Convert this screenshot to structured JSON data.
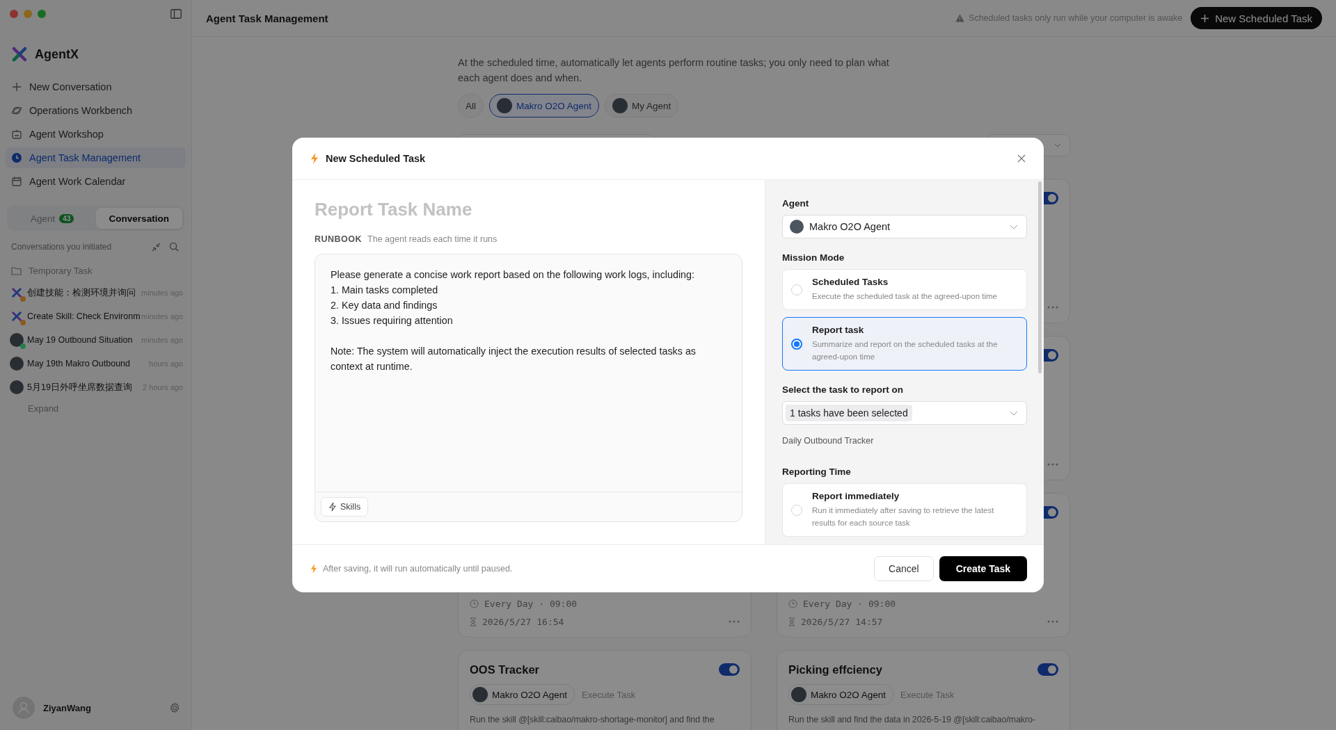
{
  "sidebar": {
    "brand": "AgentX",
    "nav": [
      {
        "kind": "new",
        "label": "New Conversation",
        "selected": false
      },
      {
        "kind": "workbench",
        "label": "Operations Workbench",
        "selected": false
      },
      {
        "kind": "workshop",
        "label": "Agent Workshop",
        "selected": false
      },
      {
        "kind": "tasks",
        "label": "Agent Task Management",
        "selected": true
      },
      {
        "kind": "calendar",
        "label": "Agent Work Calendar",
        "selected": false
      }
    ],
    "tabs": [
      {
        "label": "Agent",
        "badge": "43",
        "selected": false
      },
      {
        "label": "Conversation",
        "selected": true
      }
    ],
    "list_title": "Conversations you initiated",
    "folder": "Temporary Task",
    "conversations": [
      {
        "kind": "agentx",
        "title": "创建技能：检测环境并询问",
        "time": "minutes ago",
        "color": "#8a5a1c"
      },
      {
        "kind": "agentx",
        "title": "Create Skill: Check Environm",
        "time": "minutes ago",
        "color": "#8a5a1c"
      },
      {
        "kind": "person",
        "title": "May 19 Outbound Situation",
        "time": "minutes ago",
        "color": "#24804a"
      },
      {
        "kind": "person",
        "title": "May 19th Makro Outbound",
        "time": "hours ago"
      },
      {
        "kind": "person",
        "title": "5月19日外呼坐席数据查询",
        "time": "2 hours ago"
      }
    ],
    "expand": "Expand",
    "user": {
      "name": "ZiyanWang"
    }
  },
  "header": {
    "title": "Agent Task Management",
    "notice": "Scheduled tasks only run while your computer is awake",
    "new_button": "New Scheduled Task"
  },
  "intro": "At the scheduled time, automatically let agents perform routine tasks; you only need to plan what each agent does and when.",
  "filters": [
    {
      "kind": "plain",
      "label": "All",
      "selected": false
    },
    {
      "kind": "agent",
      "label": "Makro O2O Agent",
      "selected": true
    },
    {
      "kind": "agent",
      "label": "My Agent",
      "selected": false
    }
  ],
  "cards": [
    {
      "kind": "task",
      "enabled": true
    },
    {
      "kind": "task",
      "enabled": true
    },
    {
      "kind": "task",
      "schedule": "Every Day · 09:00",
      "last_run": "2026/5/27 16:54"
    },
    {
      "kind": "task",
      "enabled": true,
      "schedule": "Every Day · 09:00",
      "last_run": "2026/5/27 14:57"
    },
    {
      "kind": "task",
      "title": "OOS Tracker",
      "enabled": true,
      "agent": "Makro O2O Agent",
      "mode": "Execute Task",
      "description": "Run the skill @[skill:caibao/makro-shortage-monitor] and find the"
    },
    {
      "kind": "task",
      "title": "Picking effciency",
      "enabled": true,
      "agent": "Makro O2O Agent",
      "mode": "Execute Task",
      "description": "Run the skill and find the data in 2026-5-19 @[skill:caibao/makro-"
    }
  ],
  "dialog": {
    "title": "New Scheduled Task",
    "name_placeholder": "Report Task Name",
    "runbook_label": "RUNBOOK",
    "runbook_hint": "The agent reads each time it runs",
    "runbook": "Please generate a concise work report based on the following work logs, including:\n1. Main tasks completed\n2. Key data and findings\n3. Issues requiring attention\n\nNote: The system will automatically inject the execution results of selected tasks as context at runtime.",
    "skills_button": "Skills",
    "agent_label": "Agent",
    "agent_value": "Makro O2O Agent",
    "mode_label": "Mission Mode",
    "modes": [
      {
        "title": "Scheduled Tasks",
        "description": "Execute the scheduled task at the agreed-upon time",
        "selected": false
      },
      {
        "title": "Report task",
        "description": "Summarize and report on the scheduled tasks at the agreed-upon time",
        "selected": true
      }
    ],
    "report_label": "Select the task to report on",
    "report_value": "1 tasks have been selected",
    "selected_tasks": [
      "Daily Outbound Tracker"
    ],
    "time_label": "Reporting Time",
    "times": [
      {
        "title": "Report immediately",
        "description": "Run it immediately after saving to retrieve the latest results for each source task",
        "selected": false
      }
    ],
    "footer_note": "After saving, it will run automatically until paused.",
    "cancel": "Cancel",
    "create": "Create Task"
  }
}
